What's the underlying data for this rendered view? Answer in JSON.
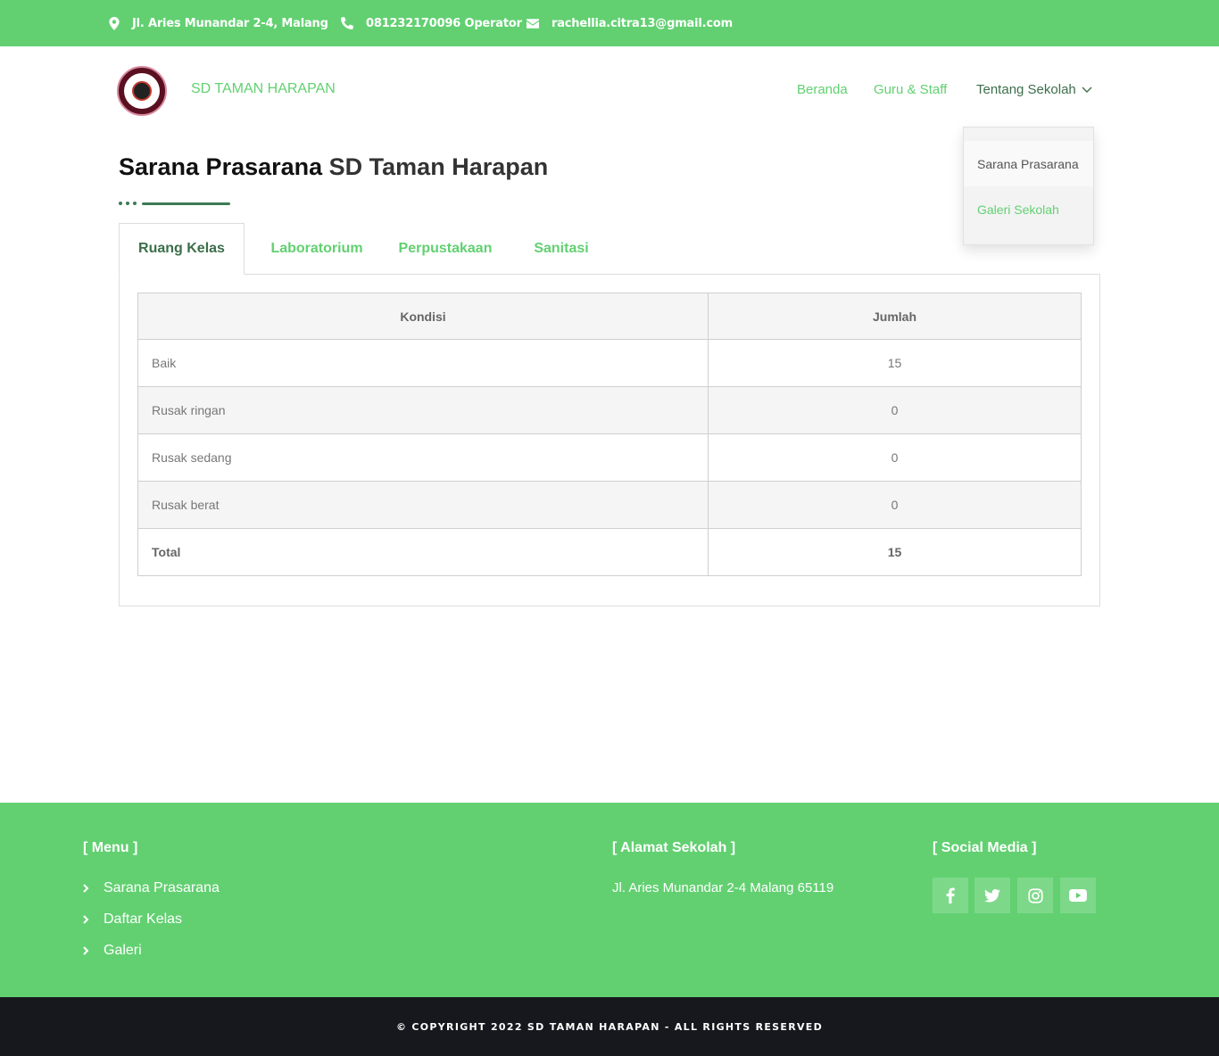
{
  "topbar": {
    "address": "Jl. Aries Munandar 2-4, Malang",
    "phone": "081232170096 Operator",
    "email": "rachellia.citra13@gmail.com"
  },
  "header": {
    "brand": "SD TAMAN HARAPAN",
    "nav": {
      "home": "Beranda",
      "staff": "Guru & Staff",
      "about": "Tentang Sekolah"
    },
    "dropdown": {
      "item1": "Sarana Prasarana",
      "item2": "Galeri Sekolah"
    }
  },
  "page": {
    "title_bold": "Sarana Prasarana",
    "title_rest": " SD Taman Harapan"
  },
  "tabs": {
    "t1": "Ruang Kelas",
    "t2": "Laboratorium",
    "t3": "Perpustakaan",
    "t4": "Sanitasi"
  },
  "table": {
    "headers": {
      "kondisi": "Kondisi",
      "jumlah": "Jumlah"
    },
    "rows": [
      {
        "kondisi": "Baik",
        "jumlah": "15"
      },
      {
        "kondisi": "Rusak ringan",
        "jumlah": "0"
      },
      {
        "kondisi": "Rusak sedang",
        "jumlah": "0"
      },
      {
        "kondisi": "Rusak berat",
        "jumlah": "0"
      },
      {
        "kondisi": "Total",
        "jumlah": "15"
      }
    ]
  },
  "footer": {
    "menu_title": "[ Menu ]",
    "menu": [
      "Sarana Prasarana",
      "Daftar Kelas",
      "Galeri"
    ],
    "address_title": "[ Alamat Sekolah ]",
    "address": "Jl. Aries Munandar 2-4 Malang 65119",
    "social_title": "[ Social Media ]",
    "social_icons": [
      "facebook-icon",
      "twitter-icon",
      "instagram-icon",
      "youtube-icon"
    ]
  },
  "copyright": "© COPYRIGHT 2022 SD TAMAN HARAPAN - ALL RIGHTS RESERVED",
  "colors": {
    "accent": "#62d071",
    "accent_dark": "#3c6e4a",
    "footer_bottom": "#17181d"
  }
}
